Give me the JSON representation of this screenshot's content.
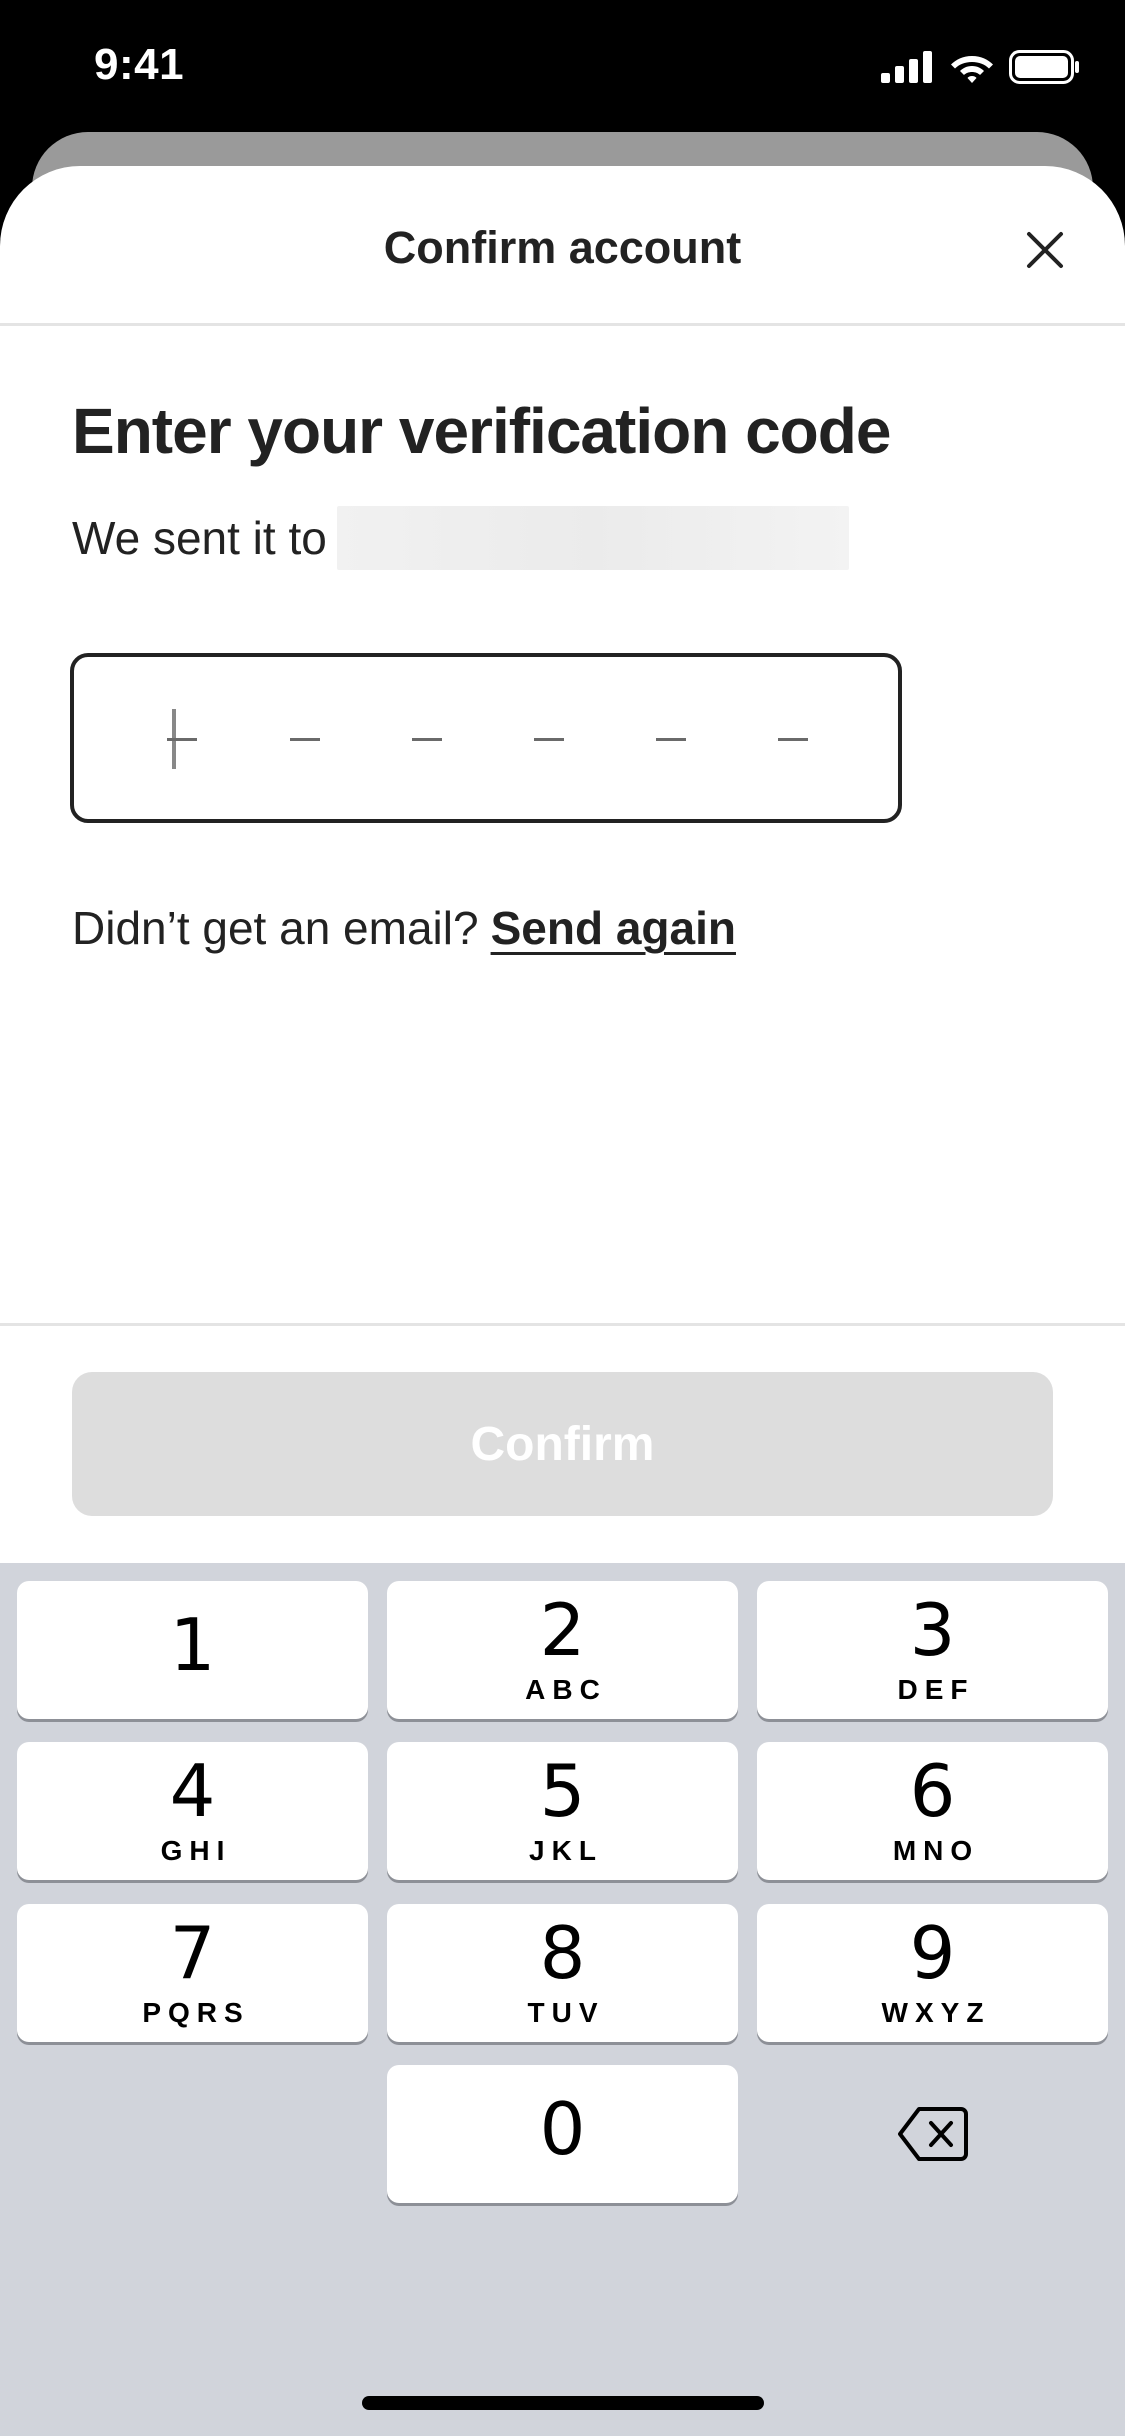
{
  "status_bar": {
    "time": "9:41"
  },
  "sheet": {
    "title": "Confirm account",
    "heading": "Enter your verification code",
    "sent_prefix": "We sent it to",
    "code_length": 6,
    "resend_prompt": "Didn’t get an email?",
    "resend_link": "Send again",
    "confirm_label": "Confirm"
  },
  "keyboard": {
    "keys": [
      {
        "num": "1",
        "letters": ""
      },
      {
        "num": "2",
        "letters": "ABC"
      },
      {
        "num": "3",
        "letters": "DEF"
      },
      {
        "num": "4",
        "letters": "GHI"
      },
      {
        "num": "5",
        "letters": "JKL"
      },
      {
        "num": "6",
        "letters": "MNO"
      },
      {
        "num": "7",
        "letters": "PQRS"
      },
      {
        "num": "8",
        "letters": "TUV"
      },
      {
        "num": "9",
        "letters": "WXYZ"
      },
      {
        "num": "0",
        "letters": ""
      }
    ]
  },
  "colors": {
    "text": "#222222",
    "button_disabled": "#dddddd",
    "keyboard_bg": "#d1d4db"
  }
}
